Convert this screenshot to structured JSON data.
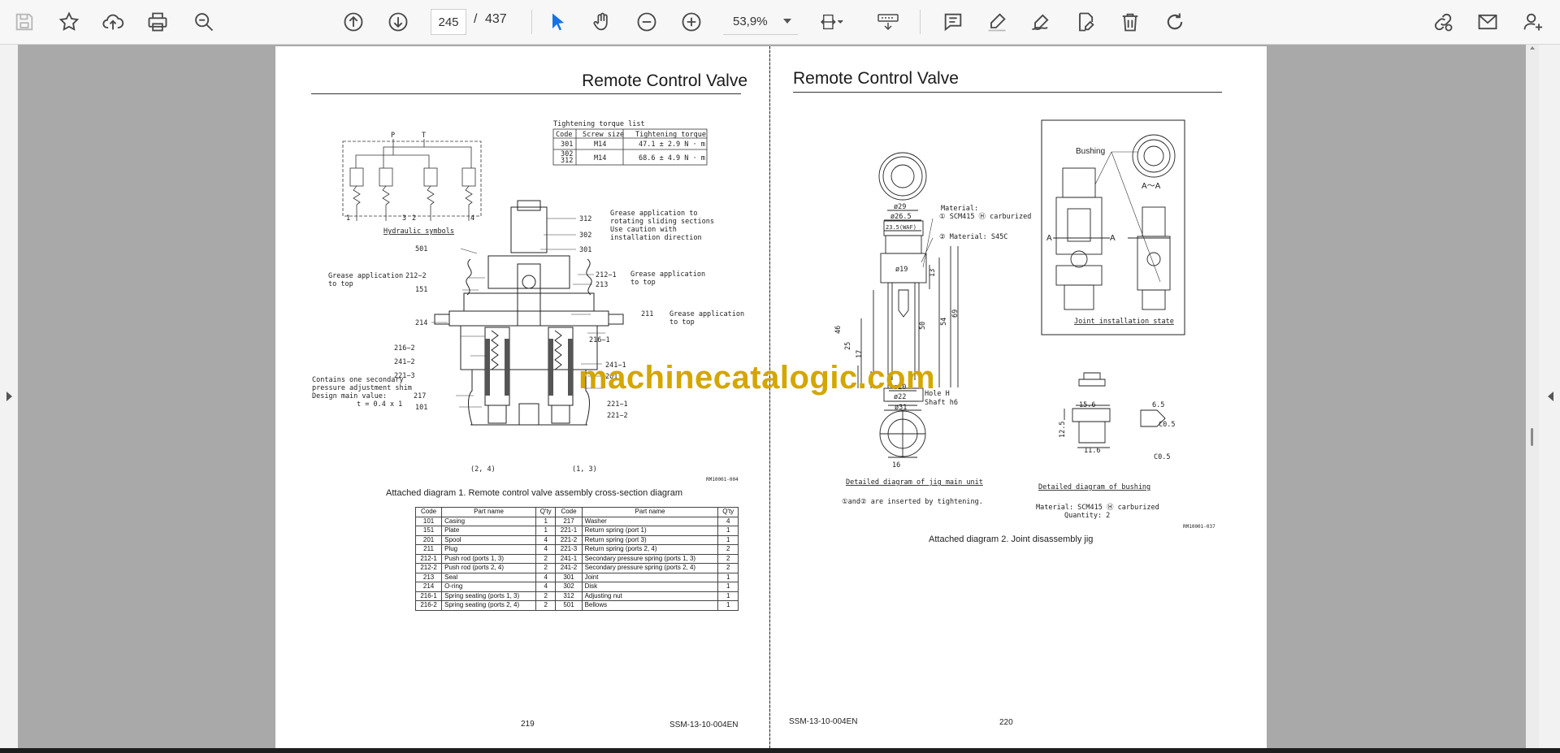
{
  "toolbar": {
    "page_current": "245",
    "page_separator": "/",
    "page_total": "437",
    "zoom": "53,9%"
  },
  "left_page": {
    "title": "Remote Control Valve",
    "torque_title": "Tightening torque list",
    "torque_headers": [
      "Code",
      "Screw size",
      "Tightening torque"
    ],
    "torque_rows": [
      {
        "code": "301",
        "size": "M14",
        "torque": "47.1 ± 2.9 N · m"
      },
      {
        "code": "302\n312",
        "size": "M14",
        "torque": "68.6 ± 4.9 N · m"
      }
    ],
    "hydraulic_label": "Hydraulic symbols",
    "labels": {
      "p": "P",
      "t": "T",
      "port1": "1",
      "port3": "3",
      "port2": "2",
      "port4": "4",
      "c312": "312",
      "c302": "302",
      "c301": "301",
      "c501": "501",
      "c212_2": "212−2",
      "c151": "151",
      "c212_1": "212−1",
      "c213": "213",
      "c211": "211",
      "c214": "214",
      "c216_2": "216−2",
      "c241_2": "241−2",
      "c221_3": "221−3",
      "c217": "217",
      "c101": "101",
      "c216_1": "216−1",
      "c241_1": "241−1",
      "c201": "201",
      "c221_1": "221−1",
      "c221_2": "221−2",
      "grease1": "Grease application to",
      "grease1b": "rotating sliding sections",
      "grease1c": "Use caution with",
      "grease1d": "installation direction",
      "grease_top": "Grease application",
      "to_top": "to top",
      "shim1": "Contains one secondary",
      "shim2": "pressure adjustment shim",
      "shim3": "Design main value:",
      "shim4": "t = 0.4 x 1",
      "ports24": "(2, 4)",
      "ports13": "(1, 3)",
      "dwg": "RM10001-004"
    },
    "caption": "Attached diagram 1. Remote control valve assembly cross-section diagram",
    "parts_headers": [
      "Code",
      "Part name",
      "Q'ty",
      "Code",
      "Part name",
      "Q'ty"
    ],
    "parts_rows": [
      [
        "101",
        "Casing",
        "1",
        "217",
        "Washer",
        "4"
      ],
      [
        "151",
        "Plate",
        "1",
        "221-1",
        "Return spring (port 1)",
        "1"
      ],
      [
        "201",
        "Spool",
        "4",
        "221-2",
        "Return spring (port 3)",
        "1"
      ],
      [
        "211",
        "Plug",
        "4",
        "221-3",
        "Return spring (ports 2, 4)",
        "2"
      ],
      [
        "212-1",
        "Push rod (ports 1, 3)",
        "2",
        "241-1",
        "Secondary pressure spring (ports 1, 3)",
        "2"
      ],
      [
        "212-2",
        "Push rod (ports 2, 4)",
        "2",
        "241-2",
        "Secondary pressure spring (ports 2, 4)",
        "2"
      ],
      [
        "213",
        "Seal",
        "4",
        "301",
        "Joint",
        "1"
      ],
      [
        "214",
        "O-ring",
        "4",
        "302",
        "Disk",
        "1"
      ],
      [
        "216-1",
        "Spring seating (ports 1, 3)",
        "2",
        "312",
        "Adjusting nut",
        "1"
      ],
      [
        "216-2",
        "Spring seating (ports 2, 4)",
        "2",
        "501",
        "Bellows",
        "1"
      ]
    ],
    "page_number": "219",
    "doc_code": "SSM-13-10-004EN"
  },
  "right_page": {
    "title": "Remote Control Valve",
    "labels": {
      "d29": "ø29",
      "d26_5": "ø26.5",
      "d23_5": "23.5(WAF)",
      "material1": "Material:",
      "material1b": "① SCM415 Ⓗ carburized",
      "material2": "② Material: S45C",
      "d19": "ø19",
      "d13": "13",
      "d54": "54",
      "d69": "69",
      "d50": "50",
      "d46": "46",
      "d25": "25",
      "d17": "17",
      "d20": "ø20",
      "d22": "ø22",
      "d31": "ø31",
      "hole": "Hole H",
      "shaft": "Shaft h6",
      "d16": "16",
      "bushing": "Bushing",
      "aa": "A～A",
      "a_left": "A",
      "a_right": "A",
      "joint_install": "Joint installation state",
      "jig_label": "Detailed diagram of jig main unit",
      "jig_note": "①and② are inserted by tightening.",
      "bush_label": "Detailed diagram of bushing",
      "bush_material": "Material: SCM415 Ⓗ carburized",
      "bush_qty": "Quantity: 2",
      "d15_6": "15.6",
      "d11_6": "11.6",
      "d6_5": "6.5",
      "d12_5": "12.5",
      "co5a": "C0.5",
      "co5b": "C0.5",
      "dwg": "RM10001-037"
    },
    "caption": "Attached diagram 2. Joint disassembly jig",
    "doc_code": "SSM-13-10-004EN",
    "page_number": "220"
  },
  "watermark": "machinecatalogic.com"
}
